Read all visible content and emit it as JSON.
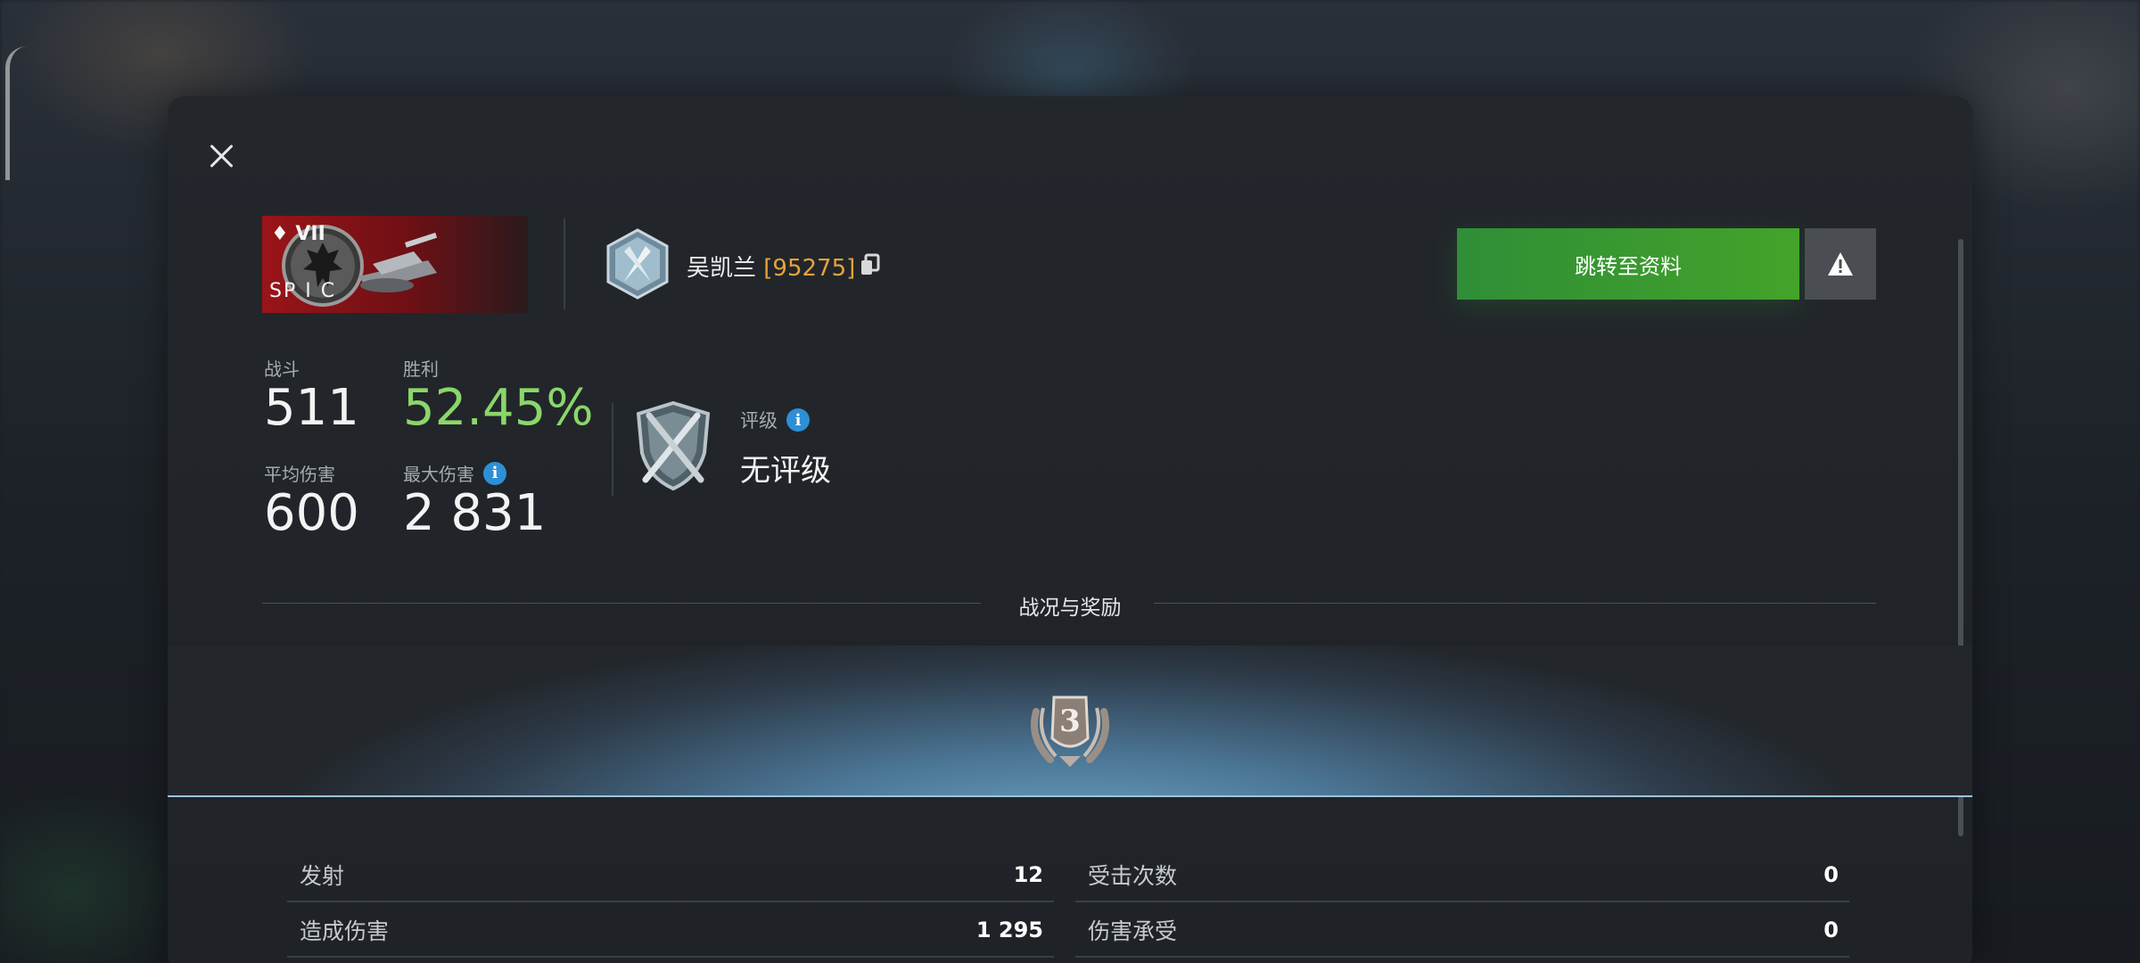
{
  "vehicle": {
    "tier": "♦ VII",
    "name": "SP I C"
  },
  "player": {
    "name": "吴凯兰",
    "clan": "[95275]"
  },
  "buttons": {
    "profile": "跳转至资料"
  },
  "stats": [
    {
      "label": "战斗",
      "value": "511"
    },
    {
      "label": "胜利",
      "value": "52.45%"
    },
    {
      "label": "平均伤害",
      "value": "600"
    },
    {
      "label": "最大伤害",
      "value": "2 831"
    }
  ],
  "rating": {
    "label": "评级",
    "value": "无评级"
  },
  "section": {
    "title": "战况与奖励"
  },
  "medal": {
    "value": "3"
  },
  "battle_stats": [
    {
      "label": "发射",
      "value": "12"
    },
    {
      "label": "受击次数",
      "value": "0"
    },
    {
      "label": "造成伤害",
      "value": "1 295"
    },
    {
      "label": "伤害承受",
      "value": "0"
    }
  ],
  "colors": {
    "win_rate": "#8bd66a",
    "clan_tag": "#e8a33a",
    "primary_button": "#3a9a30",
    "info": "#2d8fd6"
  },
  "icons": [
    "close-icon",
    "copy-icon",
    "warning-icon",
    "info-icon",
    "rank-badge-icon",
    "rating-shield-icon",
    "mastery-medal-icon"
  ]
}
